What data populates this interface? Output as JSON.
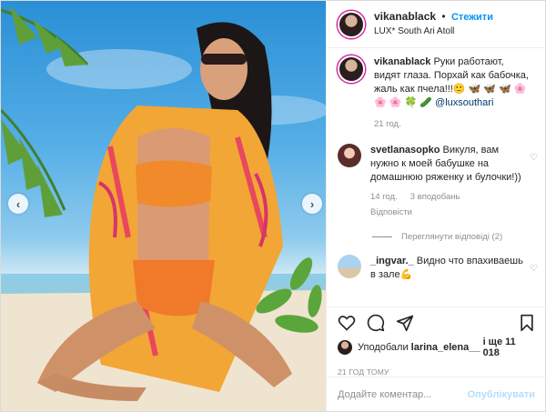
{
  "header": {
    "username": "vikanablack",
    "separator": "•",
    "follow_label": "Стежити",
    "location": "LUX* South Ari Atoll"
  },
  "caption": {
    "username": "vikanablack",
    "text": "Руки работают, видят глаза. Порхай как бабочка, жаль как пчела!!!🙂 🦋 🦋 🦋 🌸 🌸 🌸 🍀 🥒",
    "mention": "@luxsouthari",
    "time": "21 год."
  },
  "comments": [
    {
      "username": "svetlanasopko",
      "text": "Викуля, вам нужно к моей бабушке на домашнюю ряженку и булочки!))",
      "time": "14 год.",
      "likes": "3 вподобань",
      "reply": "Відповісти"
    },
    {
      "username": "_ingvar._",
      "text": "Видно что впахиваешь в зале💪"
    }
  ],
  "view_replies": "Переглянути відповіді (2)",
  "likes": {
    "prefix": "Уподобали",
    "user": "larina_elena__",
    "suffix": "і ще 11 018"
  },
  "post_date": "21 ГОД ТОМУ",
  "add_comment": {
    "placeholder": "Додайте коментар...",
    "publish": "Опублікувати"
  },
  "colors": {
    "accent": "#0095f6",
    "active_dot": "#3897f0"
  },
  "icons": [
    "heart-icon",
    "comment-icon",
    "share-icon",
    "bookmark-icon",
    "chevron-left-icon",
    "chevron-right-icon"
  ]
}
